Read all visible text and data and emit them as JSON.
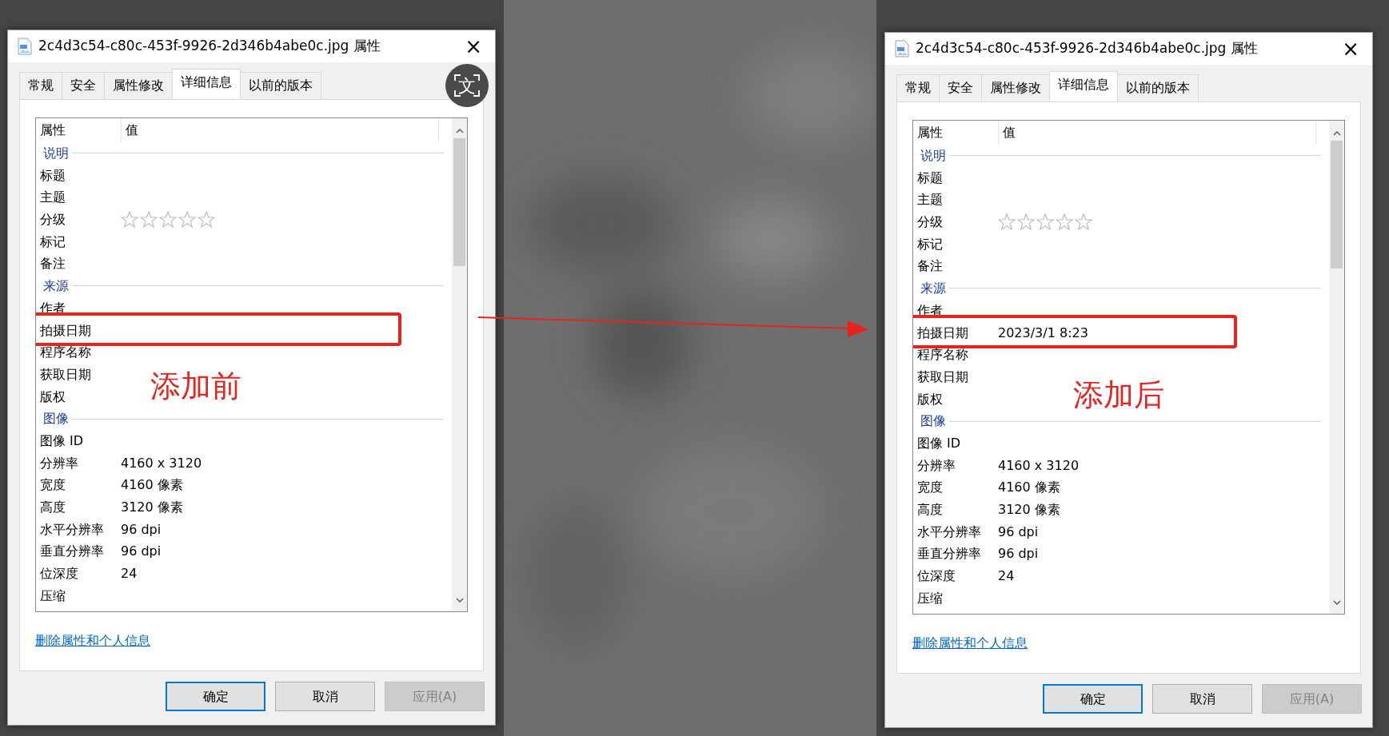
{
  "annotation_arrow": true,
  "dialogs": [
    {
      "title": "2c4d3c54-c80c-453f-9926-2d346b4abe0c.jpg 属性",
      "close": "×",
      "overlay_glyph": "文",
      "note": "添加前",
      "tabs": [
        {
          "label": "常规",
          "selected": false
        },
        {
          "label": "安全",
          "selected": false
        },
        {
          "label": "属性修改",
          "selected": false
        },
        {
          "label": "详细信息",
          "selected": true
        },
        {
          "label": "以前的版本",
          "selected": false
        }
      ],
      "columns": [
        "属性",
        "值"
      ],
      "rows": [
        {
          "kind": "group",
          "label": "说明"
        },
        {
          "kind": "prop",
          "label": "标题",
          "boxed": false
        },
        {
          "kind": "prop",
          "label": "主题",
          "boxed": false
        },
        {
          "kind": "rating",
          "label": "分级",
          "stars": 0,
          "boxed": false
        },
        {
          "kind": "prop",
          "label": "标记",
          "boxed": false
        },
        {
          "kind": "prop",
          "label": "备注",
          "boxed": false
        },
        {
          "kind": "group",
          "label": "来源"
        },
        {
          "kind": "prop",
          "label": "作者",
          "boxed": false
        },
        {
          "kind": "prop",
          "label": "拍摄日期",
          "boxed": true
        },
        {
          "kind": "prop",
          "label": "程序名称",
          "boxed": false
        },
        {
          "kind": "prop",
          "label": "获取日期",
          "boxed": false
        },
        {
          "kind": "prop",
          "label": "版权",
          "boxed": false
        },
        {
          "kind": "group",
          "label": "图像"
        },
        {
          "kind": "prop",
          "label": "图像 ID",
          "boxed": false
        },
        {
          "kind": "prop",
          "label": "分辨率",
          "value": "4160 x 3120",
          "boxed": false
        },
        {
          "kind": "prop",
          "label": "宽度",
          "value": "4160 像素",
          "boxed": false
        },
        {
          "kind": "prop",
          "label": "高度",
          "value": "3120 像素",
          "boxed": false
        },
        {
          "kind": "prop",
          "label": "水平分辨率",
          "value": "96 dpi",
          "boxed": false
        },
        {
          "kind": "prop",
          "label": "垂直分辨率",
          "value": "96 dpi",
          "boxed": false
        },
        {
          "kind": "prop",
          "label": "位深度",
          "value": "24",
          "boxed": false
        },
        {
          "kind": "prop",
          "label": "压缩",
          "boxed": false
        }
      ],
      "link": "删除属性和个人信息",
      "buttons": [
        {
          "label": "确定",
          "default": true,
          "disabled": false
        },
        {
          "label": "取消",
          "default": false,
          "disabled": false
        },
        {
          "label": "应用(A)",
          "default": false,
          "disabled": true
        }
      ]
    },
    {
      "title": "2c4d3c54-c80c-453f-9926-2d346b4abe0c.jpg 属性",
      "close": "×",
      "note": "添加后",
      "tabs": [
        {
          "label": "常规",
          "selected": false
        },
        {
          "label": "安全",
          "selected": false
        },
        {
          "label": "属性修改",
          "selected": false
        },
        {
          "label": "详细信息",
          "selected": true
        },
        {
          "label": "以前的版本",
          "selected": false
        }
      ],
      "columns": [
        "属性",
        "值"
      ],
      "rows": [
        {
          "kind": "group",
          "label": "说明"
        },
        {
          "kind": "prop",
          "label": "标题",
          "boxed": false
        },
        {
          "kind": "prop",
          "label": "主题",
          "boxed": false
        },
        {
          "kind": "rating",
          "label": "分级",
          "stars": 0,
          "boxed": false
        },
        {
          "kind": "prop",
          "label": "标记",
          "boxed": false
        },
        {
          "kind": "prop",
          "label": "备注",
          "boxed": false
        },
        {
          "kind": "group",
          "label": "来源"
        },
        {
          "kind": "prop",
          "label": "作者",
          "boxed": false
        },
        {
          "kind": "prop",
          "label": "拍摄日期",
          "value": "2023/3/1 8:23",
          "boxed": true
        },
        {
          "kind": "prop",
          "label": "程序名称",
          "boxed": false
        },
        {
          "kind": "prop",
          "label": "获取日期",
          "boxed": false
        },
        {
          "kind": "prop",
          "label": "版权",
          "boxed": false
        },
        {
          "kind": "group",
          "label": "图像"
        },
        {
          "kind": "prop",
          "label": "图像 ID",
          "boxed": false
        },
        {
          "kind": "prop",
          "label": "分辨率",
          "value": "4160 x 3120",
          "boxed": false
        },
        {
          "kind": "prop",
          "label": "宽度",
          "value": "4160 像素",
          "boxed": false
        },
        {
          "kind": "prop",
          "label": "高度",
          "value": "3120 像素",
          "boxed": false
        },
        {
          "kind": "prop",
          "label": "水平分辨率",
          "value": "96 dpi",
          "boxed": false
        },
        {
          "kind": "prop",
          "label": "垂直分辨率",
          "value": "96 dpi",
          "boxed": false
        },
        {
          "kind": "prop",
          "label": "位深度",
          "value": "24",
          "boxed": false
        },
        {
          "kind": "prop",
          "label": "压缩",
          "boxed": false
        }
      ],
      "link": "删除属性和个人信息",
      "buttons": [
        {
          "label": "确定",
          "default": true,
          "disabled": false
        },
        {
          "label": "取消",
          "default": false,
          "disabled": false
        },
        {
          "label": "应用(A)",
          "default": false,
          "disabled": true
        }
      ]
    }
  ]
}
